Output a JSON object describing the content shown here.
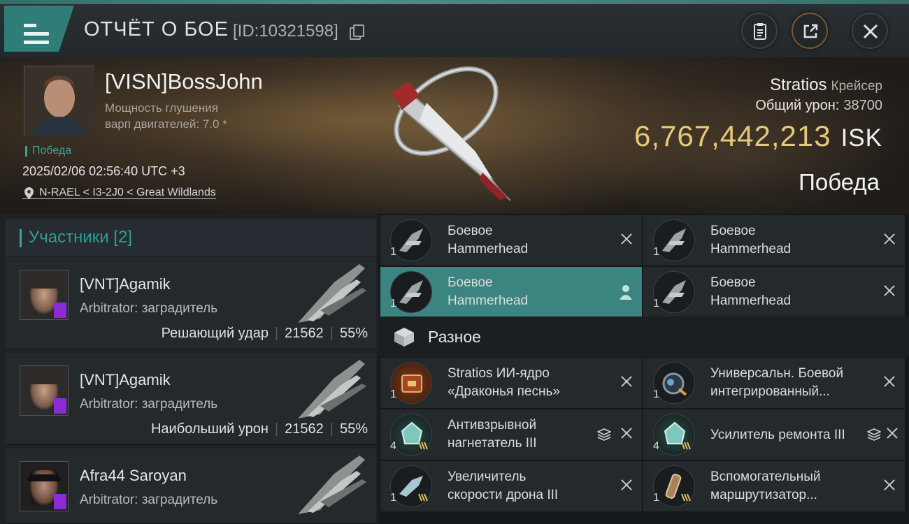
{
  "header": {
    "title": "ОТЧЁТ О БОЕ",
    "battle_id": "[ID:10321598]",
    "menu_icon": "hamburger-menu-icon",
    "buttons": {
      "report": "clipboard-icon",
      "share": "share-icon",
      "close": "close-icon"
    }
  },
  "pilot": {
    "name": "[VISN]BossJohn",
    "sub_line1": "Мощность глушения",
    "sub_line2": "варп двигателей: 7.0 *",
    "result": "Победа",
    "datetime": "2025/02/06 02:56:40 UTC +3",
    "location": "N-RAEL < I3-2J0 < Great Wildlands"
  },
  "ship": {
    "name": "Stratios",
    "class": "Крейсер",
    "damage_label": "Общий урон:",
    "damage_value": "38700",
    "isk_value": "6,767,442,213",
    "isk_unit": "ISK",
    "outcome": "Победа"
  },
  "participants": {
    "title": "Участники",
    "count": "[2]",
    "rows": [
      {
        "name": "[VNT]Agamik",
        "ship": "Arbitrator: заградитель",
        "stat_label": "Решающий удар",
        "damage": "21562",
        "percent": "55%"
      },
      {
        "name": "[VNT]Agamik",
        "ship": "Arbitrator: заградитель",
        "stat_label": "Наибольший урон",
        "damage": "21562",
        "percent": "55%"
      },
      {
        "name": "Afra44 Saroyan",
        "ship": "Arbitrator: заградитель"
      }
    ]
  },
  "drones": [
    {
      "qty": "1",
      "line1": "Боевое",
      "line2": "Hammerhead"
    },
    {
      "qty": "1",
      "line1": "Боевое",
      "line2": "Hammerhead"
    },
    {
      "qty": "1",
      "line1": "Боевое",
      "line2": "Hammerhead"
    },
    {
      "qty": "1",
      "line1": "Боевое",
      "line2": "Hammerhead"
    }
  ],
  "misc": {
    "title": "Разное",
    "items": [
      {
        "qty": "1",
        "line1": "Stratios ИИ-ядро",
        "line2": "«Драконья песнь»",
        "icon": "ai-core-icon"
      },
      {
        "qty": "1",
        "line1": "Универсальн. Боевой",
        "line2": " интегрированный...",
        "icon": "universal-module-icon"
      },
      {
        "qty": "4",
        "line1": "Антивзрывной",
        "line2": "нагнетатель III",
        "icon": "explosion-rig-icon"
      },
      {
        "qty": "4",
        "line1": "Усилитель ремонта III",
        "line2": "",
        "icon": "repair-rig-icon"
      },
      {
        "qty": "1",
        "line1": "Увеличитель",
        "line2": "скорости дрона III",
        "icon": "drone-speed-icon"
      },
      {
        "qty": "1",
        "line1": "Вспомогательный",
        "line2": "маршрутизатор...",
        "icon": "auxiliary-router-icon"
      }
    ]
  },
  "colors": {
    "accent": "#3c847f",
    "isk": "#e8c879",
    "victory_green": "#3fa195",
    "badge_purple": "#8a2bd6"
  }
}
